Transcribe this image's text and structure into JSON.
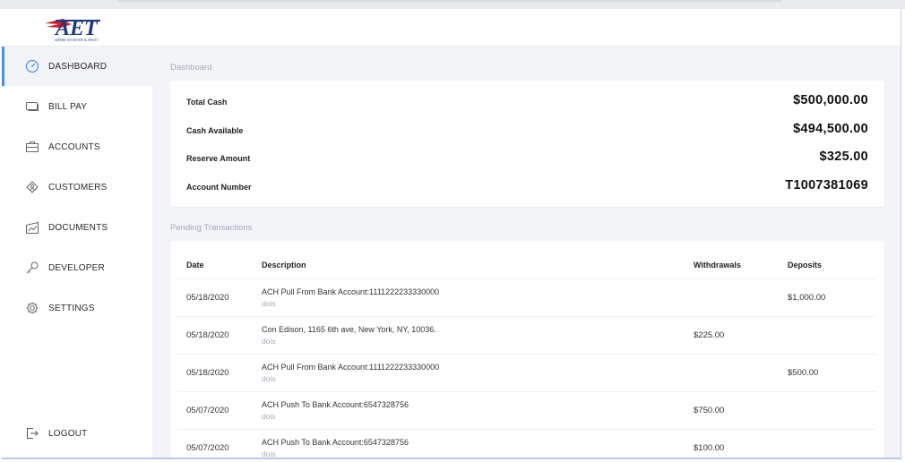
{
  "brand": {
    "logo_text": "AET",
    "logo_subtext": "AMERICAN ESTATE & TRUST"
  },
  "sidebar": {
    "items": [
      {
        "label": "DASHBOARD",
        "icon": "gauge-icon",
        "active": true
      },
      {
        "label": "BILL PAY",
        "icon": "card-icon"
      },
      {
        "label": "ACCOUNTS",
        "icon": "briefcase-icon"
      },
      {
        "label": "CUSTOMERS",
        "icon": "user-icon"
      },
      {
        "label": "DOCUMENTS",
        "icon": "chart-icon"
      },
      {
        "label": "DEVELOPER",
        "icon": "key-icon"
      },
      {
        "label": "SETTINGS",
        "icon": "gear-icon"
      }
    ],
    "logout": {
      "label": "LOGOUT",
      "icon": "logout-icon"
    }
  },
  "dashboard": {
    "title": "Dashboard",
    "summary": [
      {
        "label": "Total Cash",
        "value": "$500,000.00"
      },
      {
        "label": "Cash Available",
        "value": "$494,500.00"
      },
      {
        "label": "Reserve Amount",
        "value": "$325.00"
      },
      {
        "label": "Account Number",
        "value": "T1007381069"
      }
    ]
  },
  "pending": {
    "title": "Pending Transactions",
    "headers": {
      "date": "Date",
      "description": "Description",
      "withdrawals": "Withdrawals",
      "deposits": "Deposits"
    },
    "rows": [
      {
        "date": "05/18/2020",
        "description": "ACH Pull From Bank Account:1111222233330000",
        "sub": "dois",
        "withdrawal": "",
        "deposit": "$1,000.00"
      },
      {
        "date": "05/18/2020",
        "description": "Con Edison, 1165 6th ave, New York, NY, 10036.",
        "sub": "dois",
        "withdrawal": "$225.00",
        "deposit": ""
      },
      {
        "date": "05/18/2020",
        "description": "ACH Pull From Bank Account:1111222233330000",
        "sub": "dois",
        "withdrawal": "",
        "deposit": "$500.00"
      },
      {
        "date": "05/07/2020",
        "description": "ACH Push To Bank Account:6547328756",
        "sub": "dois",
        "withdrawal": "$750.00",
        "deposit": ""
      },
      {
        "date": "05/07/2020",
        "description": "ACH Push To Bank Account:6547328756",
        "sub": "dois",
        "withdrawal": "$100.00",
        "deposit": ""
      }
    ]
  },
  "colors": {
    "accent": "#4a90e2",
    "logo_blue": "#1f3a7a",
    "logo_red": "#c8202f",
    "muted": "#a4a9b3"
  }
}
